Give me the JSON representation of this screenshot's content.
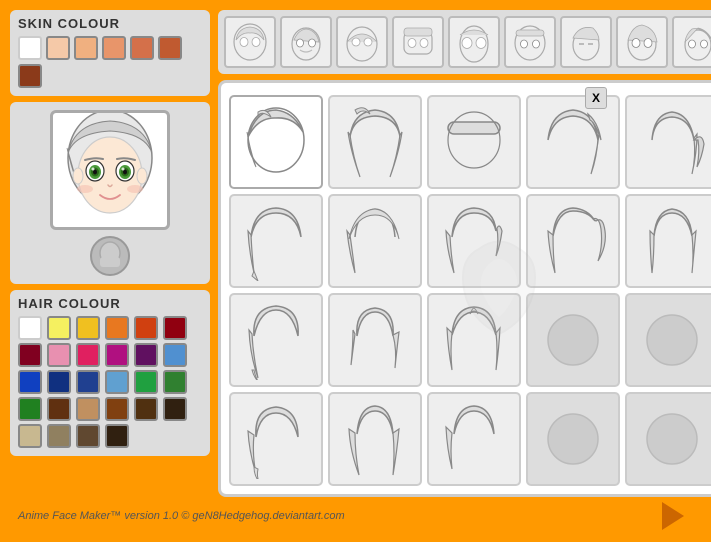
{
  "app": {
    "title": "Anime Face Maker",
    "version": "1.0",
    "credit": "Anime Face Maker™ version 1.0 © geN8Hedgehog.deviantart.com",
    "bg_color": "#FF9900"
  },
  "skin_colour": {
    "label": "SKIN COLOUR",
    "swatches": [
      "#FFFFFF",
      "#F5C9A8",
      "#F0B080",
      "#E8956A",
      "#D4704A",
      "#C05A30",
      "#8B3A1A"
    ],
    "selected_index": 0
  },
  "hair_colour": {
    "label": "HAIR COLOUR",
    "swatches": [
      "#FFFFFF",
      "#F5F0A0",
      "#F0C020",
      "#E87820",
      "#D04010",
      "#900010",
      "#800020",
      "#E890B0",
      "#E02060",
      "#B01080",
      "#601060",
      "#4080E0",
      "#1040C0",
      "#103080",
      "#204090",
      "#80C0E0",
      "#20A040",
      "#40B030",
      "#208020",
      "#603010",
      "#C09060",
      "#804010",
      "#503010",
      "#302010",
      "#C0B090",
      "#908060",
      "#604830",
      "#403020"
    ]
  },
  "close_button": {
    "label": "X"
  },
  "face_options_count": 9,
  "hair_options": {
    "count": 20,
    "selected": 0
  },
  "next_arrow": "▶"
}
